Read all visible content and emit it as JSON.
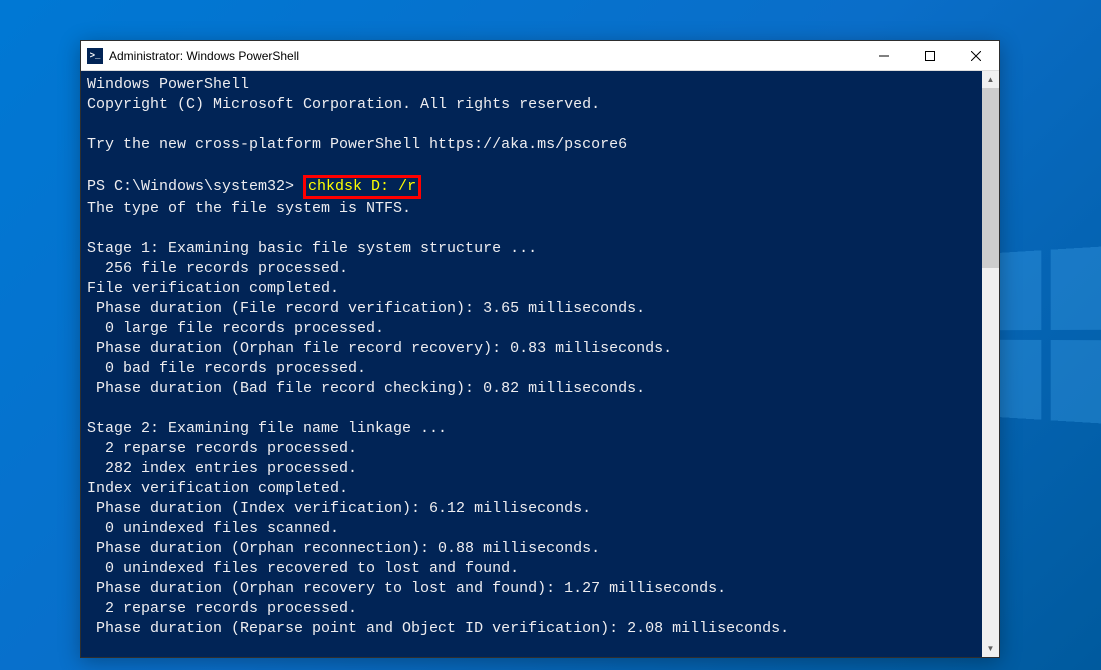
{
  "window": {
    "title": "Administrator: Windows PowerShell",
    "icon_glyph": ">_"
  },
  "console": {
    "header1": "Windows PowerShell",
    "header2": "Copyright (C) Microsoft Corporation. All rights reserved.",
    "try_line": "Try the new cross-platform PowerShell https://aka.ms/pscore6",
    "prompt": "PS C:\\Windows\\system32> ",
    "command": "chkdsk D: /r",
    "fs_type": "The type of the file system is NTFS.",
    "stage1_title": "Stage 1: Examining basic file system structure ...",
    "s1_l1": "  256 file records processed.",
    "s1_l2": "File verification completed.",
    "s1_l3": " Phase duration (File record verification): 3.65 milliseconds.",
    "s1_l4": "  0 large file records processed.",
    "s1_l5": " Phase duration (Orphan file record recovery): 0.83 milliseconds.",
    "s1_l6": "  0 bad file records processed.",
    "s1_l7": " Phase duration (Bad file record checking): 0.82 milliseconds.",
    "stage2_title": "Stage 2: Examining file name linkage ...",
    "s2_l1": "  2 reparse records processed.",
    "s2_l2": "  282 index entries processed.",
    "s2_l3": "Index verification completed.",
    "s2_l4": " Phase duration (Index verification): 6.12 milliseconds.",
    "s2_l5": "  0 unindexed files scanned.",
    "s2_l6": " Phase duration (Orphan reconnection): 0.88 milliseconds.",
    "s2_l7": "  0 unindexed files recovered to lost and found.",
    "s2_l8": " Phase duration (Orphan recovery to lost and found): 1.27 milliseconds.",
    "s2_l9": "  2 reparse records processed.",
    "s2_l10": " Phase duration (Reparse point and Object ID verification): 2.08 milliseconds."
  }
}
